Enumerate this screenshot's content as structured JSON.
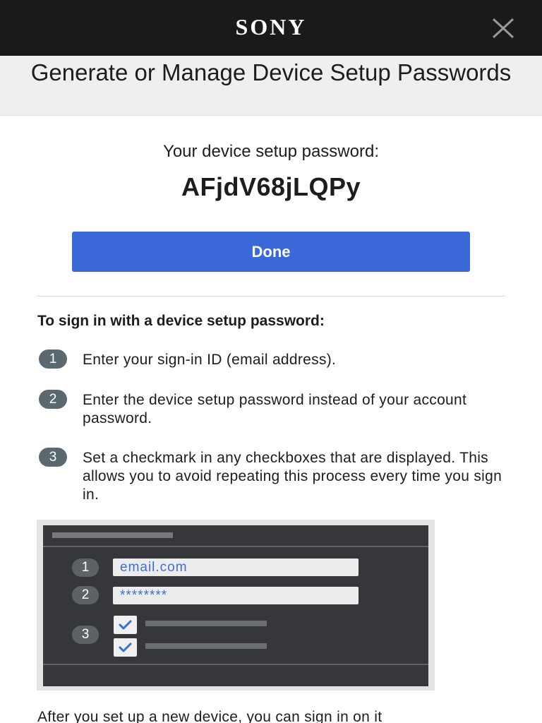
{
  "header": {
    "logo": "SONY",
    "close_icon": "close-icon"
  },
  "page": {
    "title": "Generate or Manage Device Setup Passwords"
  },
  "password": {
    "label": "Your device setup password:",
    "value": "AFjdV68jLQPy"
  },
  "done_label": "Done",
  "instructions": {
    "heading": "To sign in with a device setup password:",
    "steps": [
      {
        "number": "1",
        "text": "Enter your sign-in ID (email address)."
      },
      {
        "number": "2",
        "text": "Enter the device setup password instead of your account password."
      },
      {
        "number": "3",
        "text": "Set a checkmark in any checkboxes that are displayed. This allows you to avoid repeating this process every time you sign in."
      }
    ]
  },
  "illustration": {
    "step1": "1",
    "step2": "2",
    "step3": "3",
    "email_value": "email.com",
    "password_value": "********",
    "check_icon": "checkmark-icon"
  },
  "footer_text": "After you set up a new device, you can sign in on it",
  "colors": {
    "topbar": "#1a1a1a",
    "accent": "#3b68d9",
    "badge": "#5c6870"
  }
}
